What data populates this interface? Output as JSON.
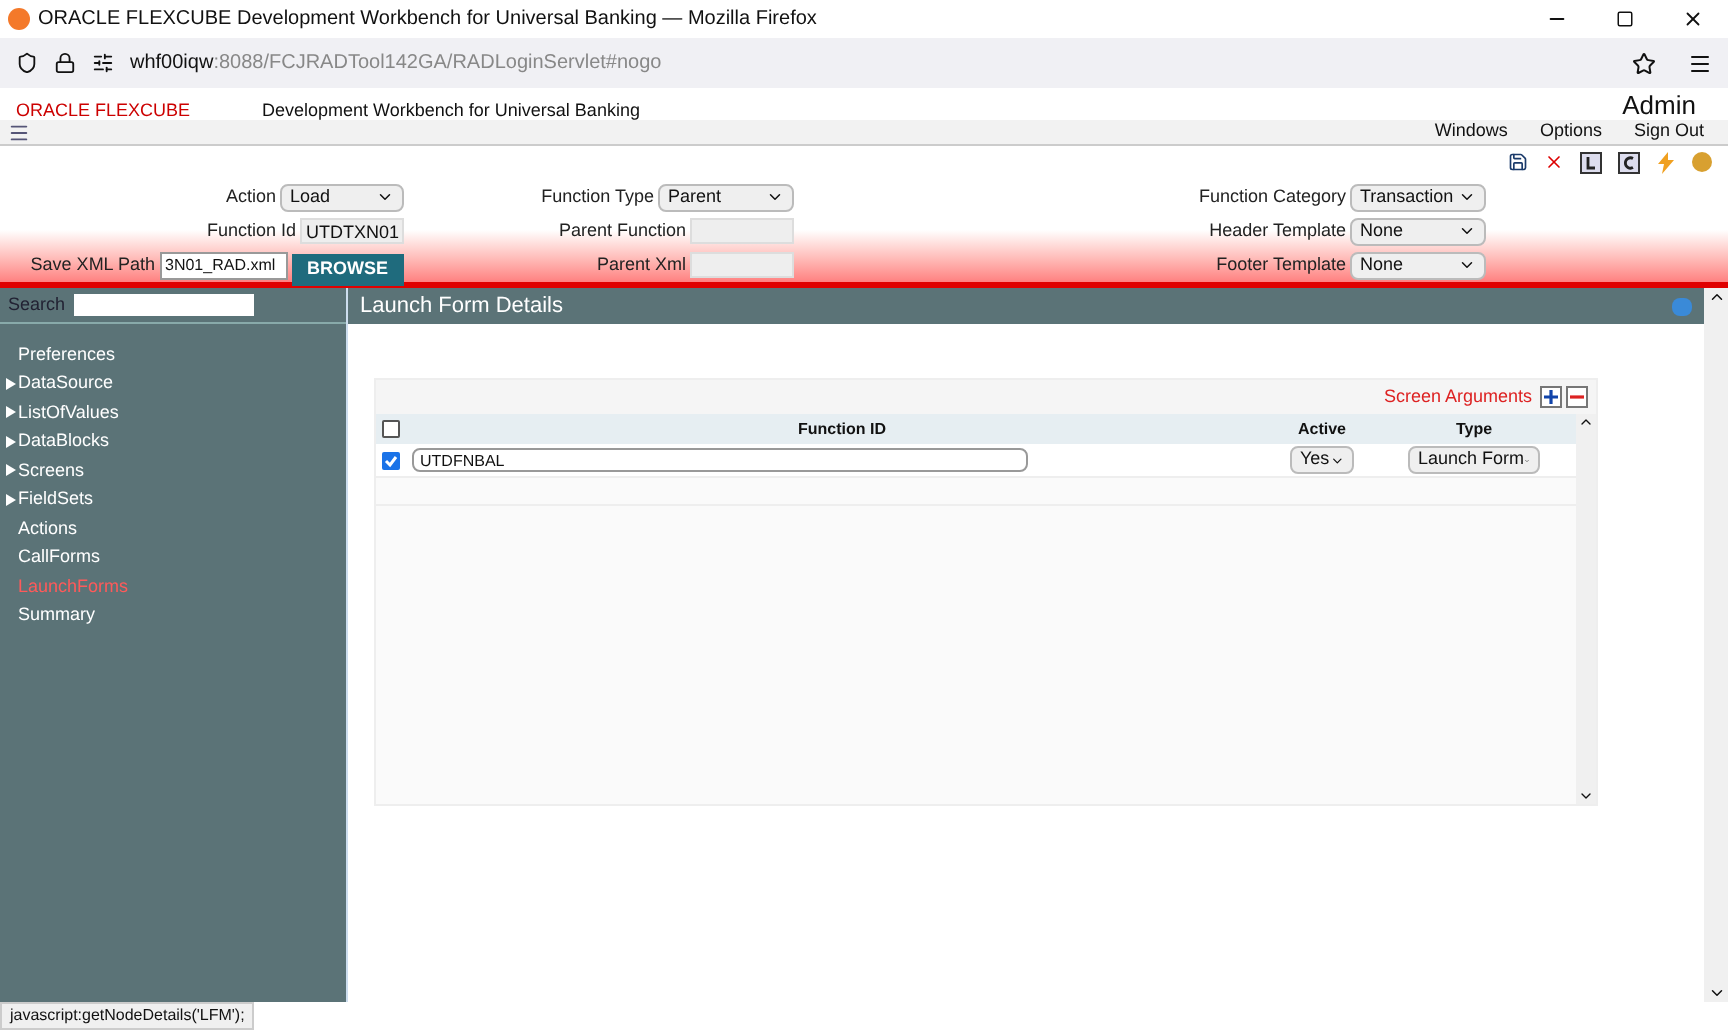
{
  "browser": {
    "title": "ORACLE FLEXCUBE Development Workbench for Universal Banking — Mozilla Firefox",
    "url_host": "whf00iqw",
    "url_path": ":8088/FCJRADTool142GA/RADLoginServlet#nogo"
  },
  "app_header": {
    "logo": "ORACLE FLEXCUBE",
    "subtitle": "Development Workbench for Universal Banking",
    "user": "Admin"
  },
  "menu": [
    "Windows",
    "Options",
    "Sign Out"
  ],
  "form": [
    {
      "label": "Action",
      "kind": "select",
      "value": "Load"
    },
    {
      "label": "Function Type",
      "kind": "select",
      "value": "Parent"
    },
    {
      "label": "Function Category",
      "kind": "select",
      "value": "Transaction"
    },
    {
      "label": "Function Id",
      "kind": "text",
      "value": "UTDTXN01"
    },
    {
      "label": "Parent Function",
      "kind": "text"
    },
    {
      "label": "Header Template",
      "kind": "select",
      "value": "None"
    },
    {
      "label": "Save XML Path",
      "kind": "path",
      "value": "3N01_RAD.xml",
      "button": "BROWSE"
    },
    {
      "label": "Parent Xml",
      "kind": "text"
    },
    {
      "label": "Footer Template",
      "kind": "select",
      "value": "None"
    }
  ],
  "sidebar": {
    "search_label": "Search",
    "items": [
      {
        "label": "Preferences",
        "expandable": false,
        "selected": false
      },
      {
        "label": "DataSource",
        "expandable": true,
        "selected": false
      },
      {
        "label": "ListOfValues",
        "expandable": true,
        "selected": false
      },
      {
        "label": "DataBlocks",
        "expandable": true,
        "selected": false
      },
      {
        "label": "Screens",
        "expandable": true,
        "selected": false
      },
      {
        "label": "FieldSets",
        "expandable": true,
        "selected": false
      },
      {
        "label": "Actions",
        "expandable": false,
        "selected": false
      },
      {
        "label": "CallForms",
        "expandable": false,
        "selected": false
      },
      {
        "label": "LaunchForms",
        "expandable": false,
        "selected": true
      },
      {
        "label": "Summary",
        "expandable": false,
        "selected": false
      }
    ]
  },
  "panel": {
    "title": "Launch Form Details",
    "section": "Screen Arguments",
    "table": {
      "columns": [
        "Function ID",
        "Active",
        "Type"
      ],
      "header_checked": false,
      "rows": [
        {
          "checked": true,
          "function_id": "UTDFNBAL",
          "active": "Yes",
          "type": "Launch Form"
        }
      ]
    }
  },
  "status_bar": "javascript:getNodeDetails('LFM');"
}
